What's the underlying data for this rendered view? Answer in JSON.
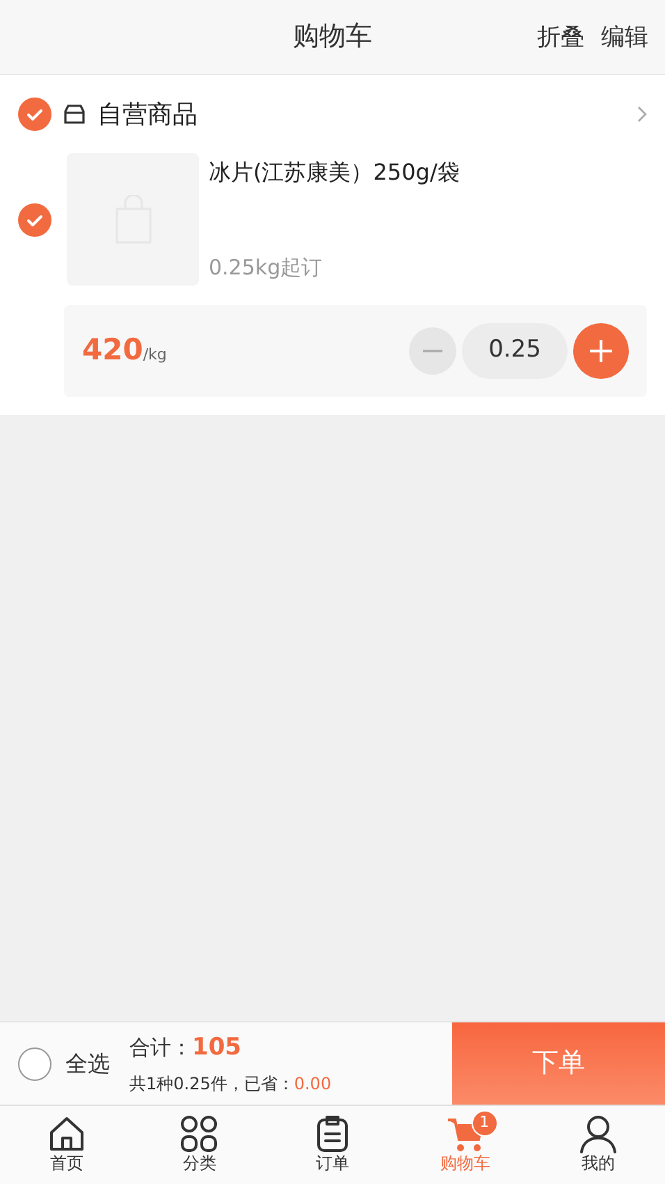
{
  "header": {
    "title": "购物车",
    "actions": [
      "折叠",
      "编辑"
    ]
  },
  "shop": {
    "name": "自营商品",
    "checked": true
  },
  "items": [
    {
      "checked": true,
      "name": "冰片(江苏康美）250g/袋",
      "min_order": "0.25kg起订",
      "price": "420",
      "unit": "/kg",
      "quantity": "0.25"
    }
  ],
  "summary": {
    "select_all": {
      "label": "全选",
      "checked": false
    },
    "total_label": "合计：",
    "total": "105",
    "detail": "共1种0.25件，已省：",
    "saved": "0.00",
    "submit": "下单"
  },
  "tabs": [
    {
      "label": "首页",
      "selected": false
    },
    {
      "label": "分类",
      "selected": false
    },
    {
      "label": "订单",
      "selected": false
    },
    {
      "label": "购物车",
      "selected": true,
      "badge": "1"
    },
    {
      "label": "我的",
      "selected": false
    }
  ]
}
